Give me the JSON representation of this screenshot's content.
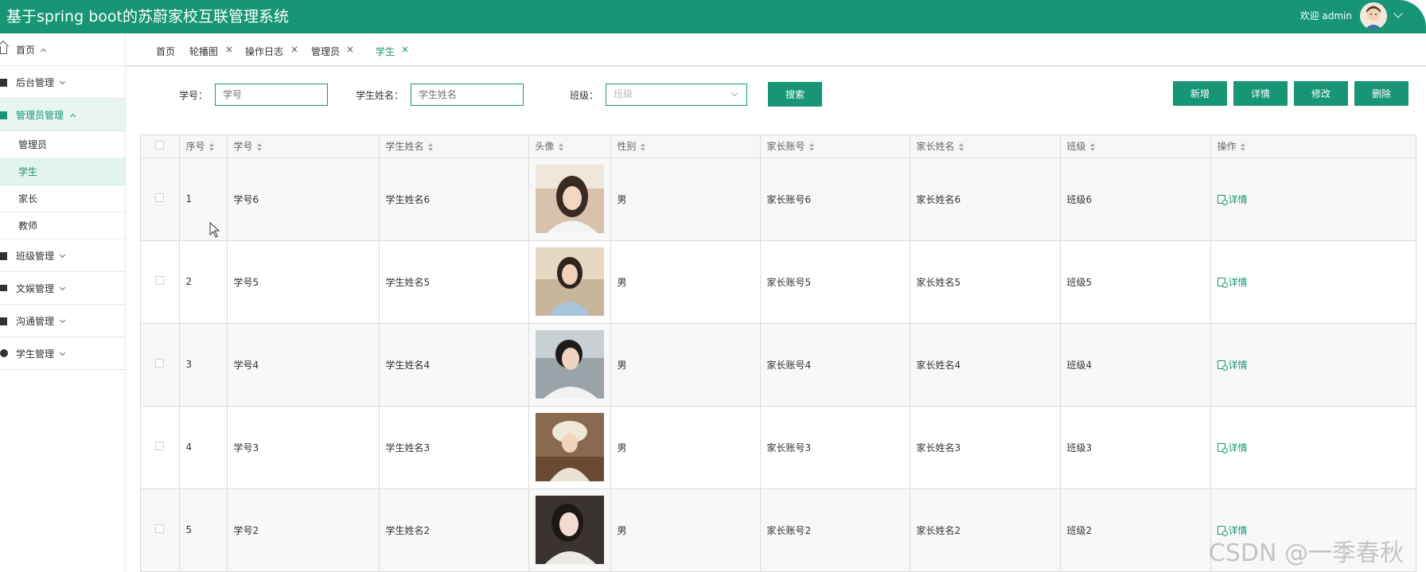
{
  "header": {
    "title": "基于spring boot的苏蔚家校互联管理系统",
    "welcome": "欢迎 admin",
    "avatar_icon": "user-avatar-icon"
  },
  "sidebar": {
    "items": [
      {
        "label": "首页",
        "icon": "home-icon",
        "expanded": true
      },
      {
        "label": "后台管理",
        "icon": "book-icon",
        "expanded": false
      },
      {
        "label": "管理员管理",
        "icon": "grid-icon",
        "expanded": true,
        "active": true,
        "children": [
          "管理员",
          "学生",
          "家长",
          "教师"
        ],
        "selected_child": "学生"
      },
      {
        "label": "班级管理",
        "icon": "book-icon",
        "expanded": false
      },
      {
        "label": "文娱管理",
        "icon": "chat-icon",
        "expanded": false
      },
      {
        "label": "沟通管理",
        "icon": "book-icon",
        "expanded": false
      },
      {
        "label": "学生管理",
        "icon": "gauge-icon",
        "expanded": false
      }
    ]
  },
  "tabs": [
    {
      "label": "首页",
      "closable": false
    },
    {
      "label": "轮播图",
      "closable": true
    },
    {
      "label": "操作日志",
      "closable": true
    },
    {
      "label": "管理员",
      "closable": true
    },
    {
      "label": "学生",
      "closable": true,
      "active": true
    }
  ],
  "search": {
    "student_no_label": "学号：",
    "student_no_placeholder": "学号",
    "student_name_label": "学生姓名：",
    "student_name_placeholder": "学生姓名",
    "class_label": "班级：",
    "class_placeholder": "班级",
    "search_button": "搜索"
  },
  "actions": {
    "add": "新增",
    "detail": "详情",
    "edit": "修改",
    "delete": "删除"
  },
  "table": {
    "columns": [
      "序号",
      "学号",
      "学生姓名",
      "头像",
      "性别",
      "家长账号",
      "家长姓名",
      "班级",
      "操作"
    ],
    "rows": [
      {
        "index": "1",
        "student_no": "学号6",
        "student_name": "学生姓名6",
        "gender": "男",
        "parent_account": "家长账号6",
        "parent_name": "家长姓名6",
        "class": "班级6",
        "op": "详情"
      },
      {
        "index": "2",
        "student_no": "学号5",
        "student_name": "学生姓名5",
        "gender": "男",
        "parent_account": "家长账号5",
        "parent_name": "家长姓名5",
        "class": "班级5",
        "op": "详情"
      },
      {
        "index": "3",
        "student_no": "学号4",
        "student_name": "学生姓名4",
        "gender": "男",
        "parent_account": "家长账号4",
        "parent_name": "家长姓名4",
        "class": "班级4",
        "op": "详情"
      },
      {
        "index": "4",
        "student_no": "学号3",
        "student_name": "学生姓名3",
        "gender": "男",
        "parent_account": "家长账号3",
        "parent_name": "家长姓名3",
        "class": "班级3",
        "op": "详情"
      },
      {
        "index": "5",
        "student_no": "学号2",
        "student_name": "学生姓名2",
        "gender": "男",
        "parent_account": "家长账号2",
        "parent_name": "家长姓名2",
        "class": "班级2",
        "op": "详情"
      }
    ]
  },
  "watermark": "CSDN @一季春秋",
  "colors": {
    "accent": "#179574"
  }
}
